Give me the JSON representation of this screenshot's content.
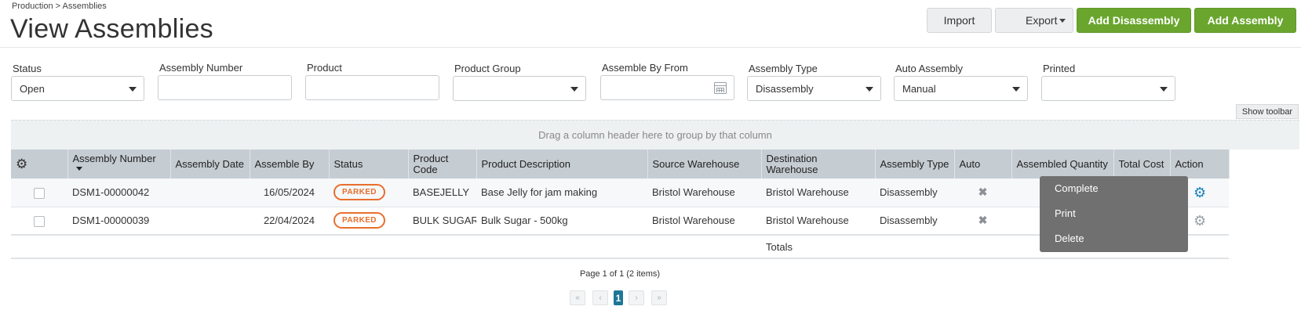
{
  "breadcrumb": "Production > Assemblies",
  "page_title": "View Assemblies",
  "actions": {
    "import": "Import",
    "export": "Export",
    "add_disassembly": "Add Disassembly",
    "add_assembly": "Add Assembly"
  },
  "filters": {
    "status": {
      "label": "Status",
      "value": "Open"
    },
    "assembly_number": {
      "label": "Assembly Number",
      "value": ""
    },
    "product": {
      "label": "Product",
      "value": ""
    },
    "product_group": {
      "label": "Product Group",
      "value": ""
    },
    "assemble_by_from": {
      "label": "Assemble By From",
      "value": ""
    },
    "assembly_type": {
      "label": "Assembly Type",
      "value": "Disassembly"
    },
    "auto_assembly": {
      "label": "Auto Assembly",
      "value": "Manual"
    },
    "printed": {
      "label": "Printed",
      "value": ""
    }
  },
  "show_toolbar": "Show toolbar",
  "group_hint": "Drag a column header here to group by that column",
  "columns": {
    "assembly_number": "Assembly Number",
    "assembly_date": "Assembly Date",
    "assemble_by": "Assemble By",
    "status": "Status",
    "product_code": "Product Code",
    "product_description": "Product Description",
    "source_warehouse": "Source Warehouse",
    "destination_warehouse": "Destination Warehouse",
    "assembly_type": "Assembly Type",
    "auto": "Auto",
    "assembled_quantity": "Assembled Quantity",
    "total_cost": "Total Cost",
    "action": "Action"
  },
  "rows": [
    {
      "assembly_number": "DSM1-00000042",
      "assembly_date": "",
      "assemble_by": "16/05/2024",
      "status": "PARKED",
      "product_code": "BASEJELLY",
      "product_description": "Base Jelly for jam making",
      "source_warehouse": "Bristol Warehouse",
      "destination_warehouse": "Bristol Warehouse",
      "assembly_type": "Disassembly"
    },
    {
      "assembly_number": "DSM1-00000039",
      "assembly_date": "",
      "assemble_by": "22/04/2024",
      "status": "PARKED",
      "product_code": "BULK SUGAR",
      "product_description": "Bulk Sugar - 500kg",
      "source_warehouse": "Bristol Warehouse",
      "destination_warehouse": "Bristol Warehouse",
      "assembly_type": "Disassembly"
    }
  ],
  "totals_label": "Totals",
  "context_menu": [
    "Complete",
    "Print",
    "Delete"
  ],
  "pager": {
    "info": "Page 1 of 1 (2 items)",
    "current_page": "1"
  },
  "colors": {
    "accent_green": "#6aa62e",
    "link_blue": "#2a7ab0",
    "overdue_red": "#e53333",
    "parked_orange": "#e86e2d"
  }
}
